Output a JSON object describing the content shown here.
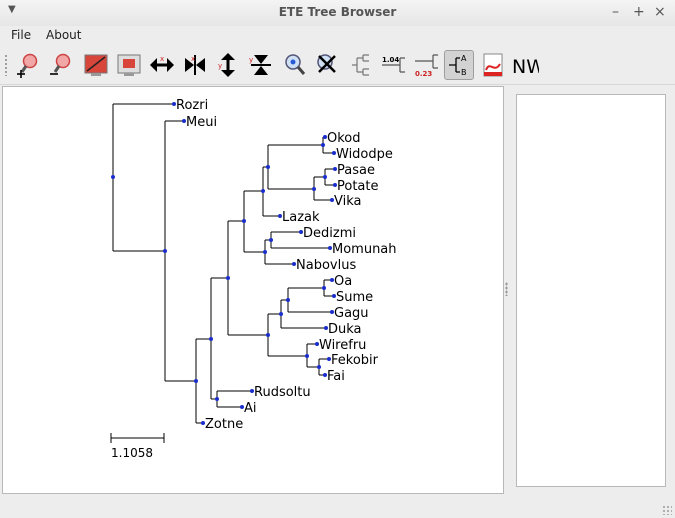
{
  "window": {
    "title": "ETE Tree Browser"
  },
  "menu": {
    "file": "File",
    "about": "About"
  },
  "toolbar": {
    "buttons": [
      {
        "icon": "zoom-in-icon"
      },
      {
        "icon": "zoom-out-icon"
      },
      {
        "icon": "fit-to-screen-icon"
      },
      {
        "icon": "fit-selection-icon"
      },
      {
        "icon": "increase-width-icon"
      },
      {
        "icon": "decrease-width-icon"
      },
      {
        "icon": "increase-height-icon"
      },
      {
        "icon": "decrease-height-icon"
      },
      {
        "icon": "search-node-icon"
      },
      {
        "icon": "clear-search-icon"
      },
      {
        "icon": "show-tree-icon"
      },
      {
        "icon": "branch-length-icon"
      },
      {
        "icon": "support-values-icon"
      },
      {
        "icon": "node-labels-icon"
      },
      {
        "icon": "render-pdf-icon"
      },
      {
        "icon": "newick-icon"
      }
    ],
    "branch_length_label": "1.04",
    "support_label": "0.23",
    "node_a": "A",
    "node_b": "B",
    "newick_label": "NW"
  },
  "tree": {
    "scale_label": "1.1058",
    "leaves": [
      {
        "name": "Rozri"
      },
      {
        "name": "Meui"
      },
      {
        "name": "Okod"
      },
      {
        "name": "Widodpe"
      },
      {
        "name": "Pasae"
      },
      {
        "name": "Potate"
      },
      {
        "name": "Vika"
      },
      {
        "name": "Lazak"
      },
      {
        "name": "Dedizmi"
      },
      {
        "name": "Momunah"
      },
      {
        "name": "Nabovlus"
      },
      {
        "name": "Oa"
      },
      {
        "name": "Sume"
      },
      {
        "name": "Gagu"
      },
      {
        "name": "Duka"
      },
      {
        "name": "Wirefru"
      },
      {
        "name": "Fekobir"
      },
      {
        "name": "Fai"
      },
      {
        "name": "Rudsoltu"
      },
      {
        "name": "Ai"
      },
      {
        "name": "Zotne"
      }
    ]
  },
  "colors": {
    "node": "#1a2ecc",
    "branch": "#000000",
    "active_tool": "#d2d2d2"
  }
}
